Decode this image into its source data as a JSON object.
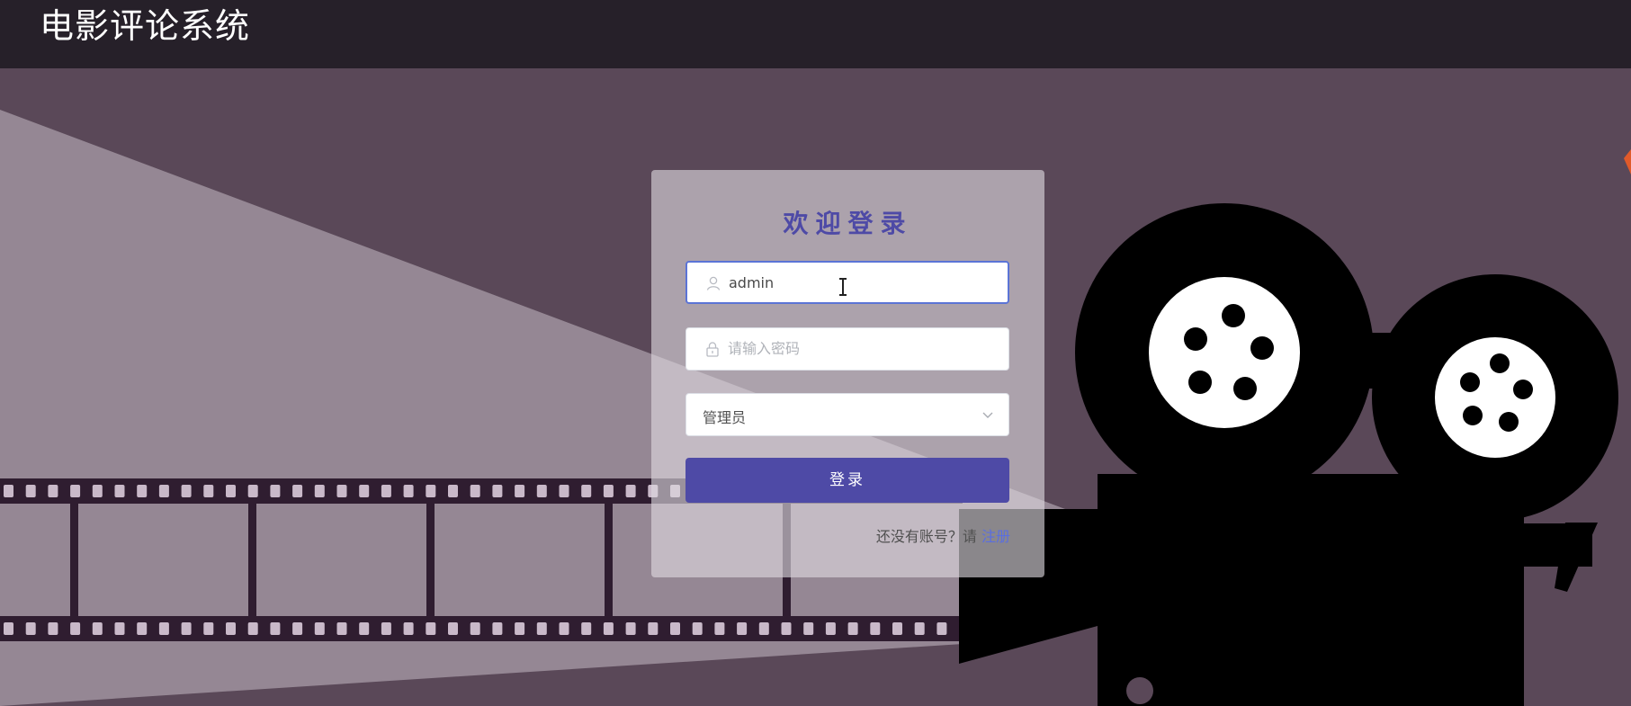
{
  "header": {
    "app_title": "电影评论系统"
  },
  "login": {
    "title": "欢迎登录",
    "username": {
      "value": "admin",
      "icon": "user-icon"
    },
    "password": {
      "placeholder": "请输入密码",
      "icon": "lock-icon"
    },
    "role": {
      "selected": "管理员",
      "icon": "chevron-down-icon"
    },
    "submit_label": "登录",
    "register_prompt": "还没有账号？请",
    "register_link": "注册"
  },
  "colors": {
    "topbar": "#262029",
    "background": "#5a4858",
    "accent": "#4e4aa6",
    "link": "#5a6ee0"
  }
}
